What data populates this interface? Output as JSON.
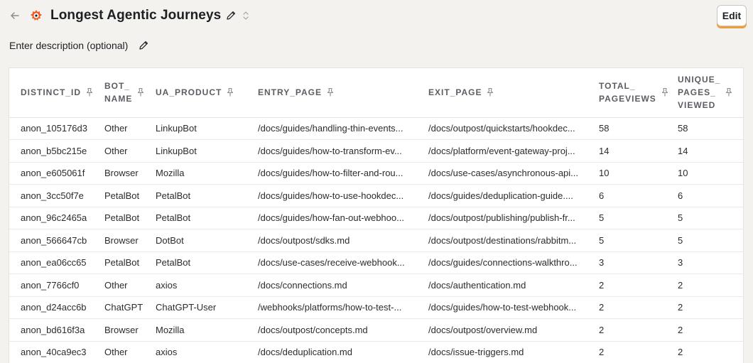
{
  "header": {
    "back_icon": "arrow-left-icon",
    "logo_icon": "hedgehog-logo-icon",
    "title": "Longest Agentic Journeys",
    "edit_title_icon": "pencil-icon",
    "expand_icon": "chevron-updown-icon",
    "edit_label": "Edit"
  },
  "description": {
    "placeholder": "Enter description (optional)",
    "edit_icon": "pencil-icon"
  },
  "table": {
    "pin_icon": "pin-icon",
    "columns": [
      {
        "label": "DISTINCT_ID"
      },
      {
        "label": "BOT_\nNAME"
      },
      {
        "label": "UA_PRODUCT"
      },
      {
        "label": "ENTRY_PAGE"
      },
      {
        "label": "EXIT_PAGE"
      },
      {
        "label": "TOTAL_\nPAGEVIEWS"
      },
      {
        "label": "UNIQUE_\nPAGES_\nVIEWED"
      }
    ],
    "rows": [
      {
        "distinct_id": "anon_105176d3",
        "bot_name": "Other",
        "ua_product": "LinkupBot",
        "entry_page": "/docs/guides/handling-thin-events...",
        "exit_page": "/docs/outpost/quickstarts/hookdec...",
        "total_pageviews": "58",
        "unique_pages_viewed": "58"
      },
      {
        "distinct_id": "anon_b5bc215e",
        "bot_name": "Other",
        "ua_product": "LinkupBot",
        "entry_page": "/docs/guides/how-to-transform-ev...",
        "exit_page": "/docs/platform/event-gateway-proj...",
        "total_pageviews": "14",
        "unique_pages_viewed": "14"
      },
      {
        "distinct_id": "anon_e605061f",
        "bot_name": "Browser",
        "ua_product": "Mozilla",
        "entry_page": "/docs/guides/how-to-filter-and-rou...",
        "exit_page": "/docs/use-cases/asynchronous-api...",
        "total_pageviews": "10",
        "unique_pages_viewed": "10"
      },
      {
        "distinct_id": "anon_3cc50f7e",
        "bot_name": "PetalBot",
        "ua_product": "PetalBot",
        "entry_page": "/docs/guides/how-to-use-hookdec...",
        "exit_page": "/docs/guides/deduplication-guide....",
        "total_pageviews": "6",
        "unique_pages_viewed": "6"
      },
      {
        "distinct_id": "anon_96c2465a",
        "bot_name": "PetalBot",
        "ua_product": "PetalBot",
        "entry_page": "/docs/guides/how-fan-out-webhoo...",
        "exit_page": "/docs/outpost/publishing/publish-fr...",
        "total_pageviews": "5",
        "unique_pages_viewed": "5"
      },
      {
        "distinct_id": "anon_566647cb",
        "bot_name": "Browser",
        "ua_product": "DotBot",
        "entry_page": "/docs/outpost/sdks.md",
        "exit_page": "/docs/outpost/destinations/rabbitm...",
        "total_pageviews": "5",
        "unique_pages_viewed": "5"
      },
      {
        "distinct_id": "anon_ea06cc65",
        "bot_name": "PetalBot",
        "ua_product": "PetalBot",
        "entry_page": "/docs/use-cases/receive-webhook...",
        "exit_page": "/docs/guides/connections-walkthro...",
        "total_pageviews": "3",
        "unique_pages_viewed": "3"
      },
      {
        "distinct_id": "anon_7766cf0",
        "bot_name": "Other",
        "ua_product": "axios",
        "entry_page": "/docs/connections.md",
        "exit_page": "/docs/authentication.md",
        "total_pageviews": "2",
        "unique_pages_viewed": "2"
      },
      {
        "distinct_id": "anon_d24acc6b",
        "bot_name": "ChatGPT",
        "ua_product": "ChatGPT-User",
        "entry_page": "/webhooks/platforms/how-to-test-...",
        "exit_page": "/docs/guides/how-to-test-webhook...",
        "total_pageviews": "2",
        "unique_pages_viewed": "2"
      },
      {
        "distinct_id": "anon_bd616f3a",
        "bot_name": "Browser",
        "ua_product": "Mozilla",
        "entry_page": "/docs/outpost/concepts.md",
        "exit_page": "/docs/outpost/overview.md",
        "total_pageviews": "2",
        "unique_pages_viewed": "2"
      },
      {
        "distinct_id": "anon_40ca9ec3",
        "bot_name": "Other",
        "ua_product": "axios",
        "entry_page": "/docs/deduplication.md",
        "exit_page": "/docs/issue-triggers.md",
        "total_pageviews": "2",
        "unique_pages_viewed": "2"
      }
    ]
  },
  "colors": {
    "background": "#f3f2ee",
    "accent": "#e9a03b",
    "logo": "#f25a1f"
  }
}
